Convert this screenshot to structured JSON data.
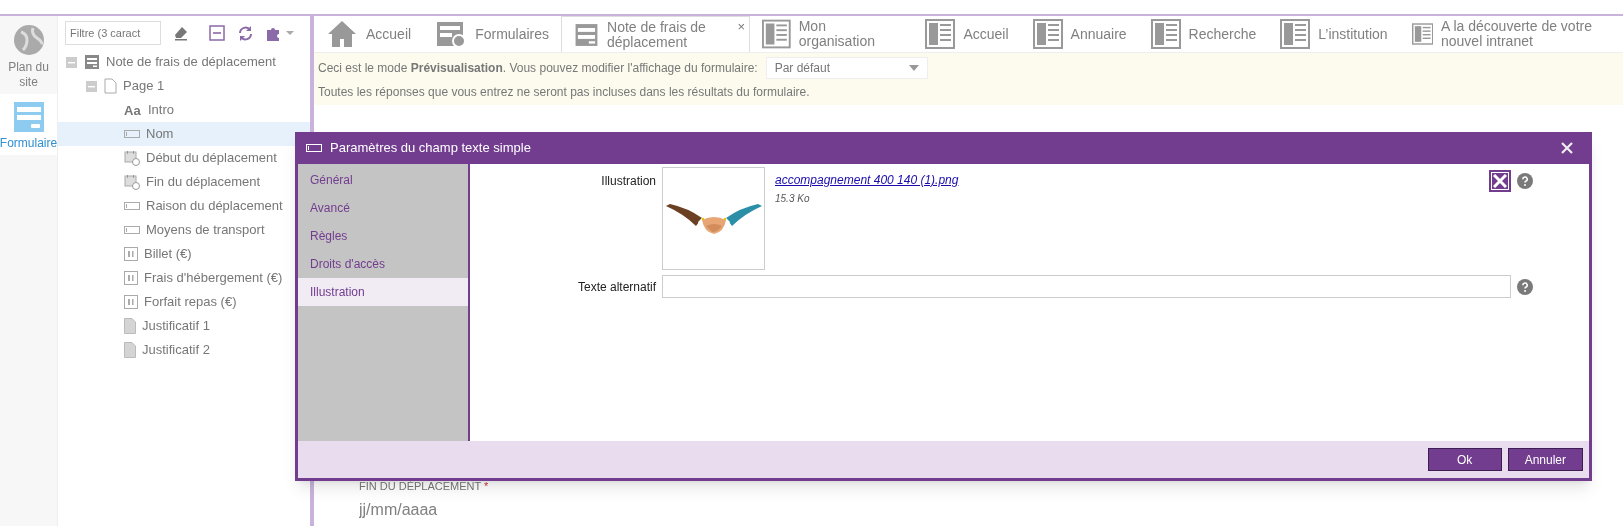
{
  "left_rail": [
    {
      "label": "Plan du site",
      "kind": "globe",
      "selected": false
    },
    {
      "label": "Formulaire",
      "kind": "form",
      "selected": true
    }
  ],
  "tree": {
    "filter_placeholder": "Filtre (3 caract",
    "nodes": [
      {
        "label": "Note de frais de déplacement",
        "kind": "form",
        "expanded": true,
        "selected": false,
        "children": [
          {
            "label": "Page 1",
            "kind": "page",
            "expanded": true,
            "selected": false,
            "children": [
              {
                "label": "Intro",
                "kind": "text",
                "icon_text": "Aa",
                "selected": false
              },
              {
                "label": "Nom",
                "kind": "textfield",
                "selected": true
              },
              {
                "label": "Début du déplacement",
                "kind": "date",
                "selected": false
              },
              {
                "label": "Fin du déplacement",
                "kind": "date",
                "selected": false
              },
              {
                "label": "Raison du déplacement",
                "kind": "textfield",
                "selected": false
              },
              {
                "label": "Moyens de transport",
                "kind": "textfield",
                "selected": false
              },
              {
                "label": "Billet (€)",
                "kind": "number",
                "selected": false
              },
              {
                "label": "Frais d'hébergement (€)",
                "kind": "number",
                "selected": false
              },
              {
                "label": "Forfait repas (€)",
                "kind": "number",
                "selected": false
              },
              {
                "label": "Justificatif 1",
                "kind": "file",
                "selected": false
              },
              {
                "label": "Justificatif 2",
                "kind": "file",
                "selected": false
              }
            ]
          }
        ]
      }
    ]
  },
  "tabs": [
    {
      "label": "Accueil",
      "kind": "home",
      "selected": false
    },
    {
      "label": "Formulaires",
      "kind": "forms",
      "selected": false
    },
    {
      "label": "Note de frais de déplacement",
      "kind": "form",
      "selected": true,
      "close": "×"
    },
    {
      "label": "Mon organisation",
      "kind": "page",
      "selected": false
    },
    {
      "label": "Accueil",
      "kind": "page",
      "selected": false
    },
    {
      "label": "Annuaire",
      "kind": "page",
      "selected": false
    },
    {
      "label": "Recherche",
      "kind": "page",
      "selected": false
    },
    {
      "label": "L’institution",
      "kind": "page",
      "selected": false
    },
    {
      "label": "A la découverte de votre nouvel intranet",
      "kind": "page",
      "selected": false
    }
  ],
  "notice": {
    "text": "Ceci est le mode **Prévisualisation**. Vous pouvez modifier l'affichage du formulaire:",
    "display_select": "Par défaut",
    "note": "Toutes les réponses que vous entrez ne seront pas incluses dans les résultats du formulaire."
  },
  "form_preview": {
    "field_label": "FIN DU DÉPLACEMENT",
    "required_mark": "*",
    "placeholder": "jj/mm/aaaa"
  },
  "dialog": {
    "title": "Paramètres du champ texte simple",
    "tabs": [
      {
        "label": "Général",
        "selected": false
      },
      {
        "label": "Avancé",
        "selected": false
      },
      {
        "label": "Règles",
        "selected": false
      },
      {
        "label": "Droits d'accès",
        "selected": false
      },
      {
        "label": "Illustration",
        "selected": true
      }
    ],
    "illustration_label": "Illustration",
    "file_link": "accompagnement 400 140 (1).png",
    "file_size": "15.3 Ko",
    "alt_label": "Texte alternatif",
    "buttons": [
      "Ok",
      "Annuler"
    ]
  }
}
